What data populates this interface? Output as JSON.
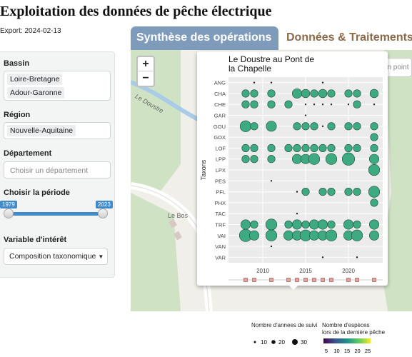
{
  "app": {
    "title": "Exploitation des données de pêche électrique",
    "export_text": "Export: 2024-02-13"
  },
  "sidebar": {
    "basin_label": "Bassin",
    "basins": [
      "Loire-Bretagne",
      "Adour-Garonne"
    ],
    "region_label": "Région",
    "regions": [
      "Nouvelle-Aquitaine"
    ],
    "department_label": "Département",
    "department_placeholder": "Choisir un département",
    "period_label": "Choisir la période",
    "period_start": "1979",
    "period_end": "2023",
    "variable_label": "Variable d'intérêt",
    "variable_value": "Composition taxonomique"
  },
  "tabs": [
    {
      "label": "Synthèse des opérations",
      "active": true
    },
    {
      "label": "Données & Traitements",
      "active": false
    }
  ],
  "map": {
    "zoom_in": "+",
    "zoom_out": "−",
    "search_placeholder": "Zoomer sur un point",
    "river_label": "Le Doustre",
    "place_label": "Le Bos"
  },
  "chart_data": {
    "type": "scatter",
    "title": "Le Doustre au Pont de la Chapelle",
    "ylabel": "Taxons",
    "xlabel": "",
    "xlim": [
      2006,
      2024
    ],
    "xticks": [
      2010,
      2015,
      2020
    ],
    "categories": [
      "ANG",
      "CHA",
      "CHE",
      "GAR",
      "GOU",
      "GOX",
      "LOF",
      "LPP",
      "LPX",
      "PES",
      "PFL",
      "PHX",
      "TAC",
      "TRF",
      "VAI",
      "VAN",
      "VAR"
    ],
    "years": [
      2008,
      2009,
      2011,
      2013,
      2014,
      2015,
      2016,
      2017,
      2018,
      2020,
      2021,
      2023
    ],
    "series": [
      {
        "taxon": "ANG",
        "points": [
          [
            2009,
            1
          ],
          [
            2011,
            1
          ],
          [
            2017,
            1
          ]
        ]
      },
      {
        "taxon": "CHA",
        "points": [
          [
            2008,
            5
          ],
          [
            2009,
            5
          ],
          [
            2011,
            5
          ],
          [
            2014,
            10
          ],
          [
            2015,
            7
          ],
          [
            2016,
            5
          ],
          [
            2017,
            7
          ],
          [
            2018,
            5
          ],
          [
            2020,
            5
          ],
          [
            2021,
            5
          ],
          [
            2023,
            7
          ]
        ]
      },
      {
        "taxon": "CHE",
        "points": [
          [
            2008,
            5
          ],
          [
            2009,
            5
          ],
          [
            2011,
            5
          ],
          [
            2013,
            5
          ],
          [
            2015,
            1
          ],
          [
            2016,
            1
          ],
          [
            2017,
            1
          ],
          [
            2018,
            1
          ],
          [
            2020,
            1
          ],
          [
            2021,
            5
          ],
          [
            2023,
            1
          ]
        ]
      },
      {
        "taxon": "GAR",
        "points": [
          [
            2015,
            1
          ]
        ]
      },
      {
        "taxon": "GOU",
        "points": [
          [
            2008,
            15
          ],
          [
            2009,
            5
          ],
          [
            2011,
            12
          ],
          [
            2014,
            5
          ],
          [
            2015,
            5
          ],
          [
            2016,
            5
          ],
          [
            2017,
            1
          ],
          [
            2018,
            5
          ],
          [
            2020,
            5
          ],
          [
            2021,
            5
          ],
          [
            2023,
            5
          ]
        ]
      },
      {
        "taxon": "GOX",
        "points": [
          [
            2023,
            5
          ]
        ]
      },
      {
        "taxon": "LOF",
        "points": [
          [
            2008,
            5
          ],
          [
            2009,
            5
          ],
          [
            2011,
            5
          ],
          [
            2013,
            5
          ],
          [
            2014,
            5
          ],
          [
            2015,
            5
          ],
          [
            2016,
            5
          ],
          [
            2017,
            5
          ],
          [
            2018,
            5
          ],
          [
            2020,
            5
          ],
          [
            2021,
            5
          ],
          [
            2023,
            5
          ]
        ]
      },
      {
        "taxon": "LPP",
        "points": [
          [
            2008,
            5
          ],
          [
            2009,
            5
          ],
          [
            2011,
            5
          ],
          [
            2014,
            10
          ],
          [
            2015,
            10
          ],
          [
            2016,
            15
          ],
          [
            2018,
            15
          ],
          [
            2020,
            20
          ],
          [
            2023,
            10
          ]
        ]
      },
      {
        "taxon": "LPX",
        "points": [
          [
            2023,
            15
          ]
        ]
      },
      {
        "taxon": "PES",
        "points": [
          [
            2011,
            1
          ]
        ]
      },
      {
        "taxon": "PFL",
        "points": [
          [
            2014,
            1
          ],
          [
            2015,
            5
          ],
          [
            2017,
            5
          ],
          [
            2018,
            5
          ],
          [
            2020,
            5
          ],
          [
            2021,
            5
          ],
          [
            2023,
            15
          ]
        ]
      },
      {
        "taxon": "PHX",
        "points": [
          [
            2023,
            5
          ]
        ]
      },
      {
        "taxon": "TAC",
        "points": [
          [
            2014,
            1
          ]
        ]
      },
      {
        "taxon": "TRF",
        "points": [
          [
            2008,
            10
          ],
          [
            2009,
            5
          ],
          [
            2011,
            15
          ],
          [
            2013,
            5
          ],
          [
            2014,
            10
          ],
          [
            2015,
            5
          ],
          [
            2016,
            10
          ],
          [
            2017,
            10
          ],
          [
            2018,
            5
          ],
          [
            2020,
            10
          ],
          [
            2021,
            5
          ],
          [
            2023,
            10
          ]
        ]
      },
      {
        "taxon": "VAI",
        "points": [
          [
            2008,
            20
          ],
          [
            2009,
            10
          ],
          [
            2011,
            15
          ],
          [
            2013,
            10
          ],
          [
            2014,
            10
          ],
          [
            2015,
            15
          ],
          [
            2016,
            10
          ],
          [
            2017,
            10
          ],
          [
            2018,
            15
          ],
          [
            2020,
            10
          ],
          [
            2021,
            15
          ],
          [
            2023,
            10
          ]
        ]
      },
      {
        "taxon": "VAN",
        "points": [
          [
            2011,
            1
          ]
        ]
      },
      {
        "taxon": "VAR",
        "points": [
          [
            2017,
            1
          ],
          [
            2021,
            1
          ]
        ]
      }
    ],
    "size_legend_title": "Nombre d'annees de suivi",
    "size_legend_values": [
      10,
      20,
      30
    ],
    "color_legend_title_1": "Nombre d'espèces",
    "color_legend_title_2": "lors de la dernière pêche",
    "color_legend_ticks": [
      5,
      10,
      15,
      20,
      25
    ],
    "colors": {
      "point_fill": "#3eaa82",
      "point_stroke": "#1f4a3a",
      "panel_bg": "#ebebeb",
      "grid": "#ffffff"
    }
  }
}
